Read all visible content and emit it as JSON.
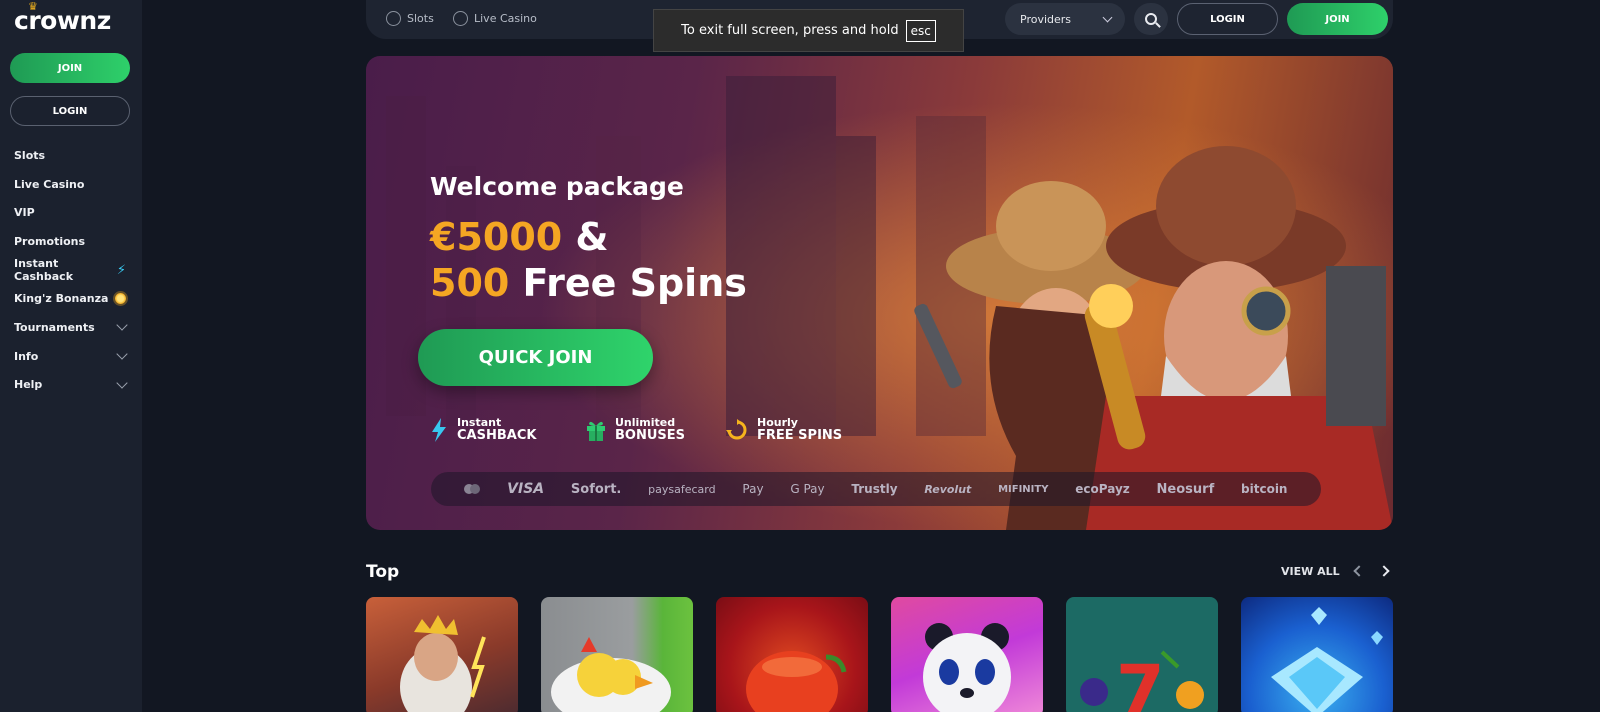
{
  "sidebar": {
    "logo": "crownz",
    "join_label": "JOIN",
    "login_label": "LOGIN",
    "items": [
      {
        "label": "Slots"
      },
      {
        "label": "Live Casino"
      },
      {
        "label": "VIP"
      },
      {
        "label": "Promotions"
      },
      {
        "label": "Instant Cashback"
      },
      {
        "label": "King'z Bonanza"
      },
      {
        "label": "Tournaments"
      },
      {
        "label": "Info"
      },
      {
        "label": "Help"
      }
    ]
  },
  "topbar": {
    "slots_label": "Slots",
    "live_casino_label": "Live Casino",
    "providers_label": "Providers",
    "login_label": "LOGIN",
    "join_label": "JOIN"
  },
  "toast": {
    "text": "To exit full screen, press and hold",
    "key": "esc"
  },
  "hero": {
    "title": "Welcome package",
    "amount": "€5000",
    "amount_rest": " &",
    "spins": "500",
    "spins_rest": " Free Spins",
    "cta": "QUICK JOIN",
    "features": [
      {
        "line1": "Instant",
        "line2": "CASHBACK"
      },
      {
        "line1": "Unlimited",
        "line2": "BONUSES"
      },
      {
        "line1": "Hourly",
        "line2": "FREE SPINS"
      }
    ],
    "payments": [
      "VISA",
      "Sofort.",
      "paysafecard",
      "Pay",
      "G Pay",
      "Trustly",
      "Revolut",
      "MIFINITY",
      "ecoPayz",
      "Neosurf",
      "bitcoin"
    ]
  },
  "top_section": {
    "title": "Top",
    "view_all": "VIEW ALL"
  },
  "colors": {
    "accent_green": "#2ed06a",
    "gold": "#f5a623",
    "background": "#121722"
  }
}
